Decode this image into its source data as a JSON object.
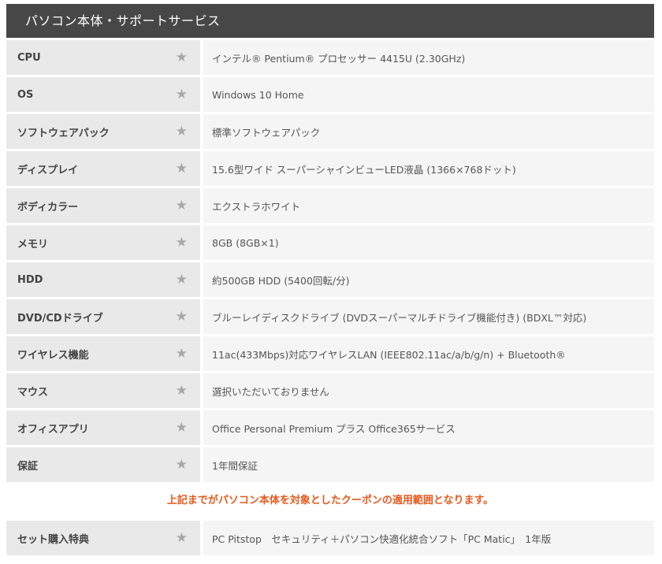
{
  "header": {
    "title": "パソコン本体・サポートサービス"
  },
  "star_icon": "★",
  "spec_rows": [
    {
      "label": "CPU",
      "value": "インテル® Pentium® プロセッサー 4415U (2.30GHz)"
    },
    {
      "label": "OS",
      "value": "Windows 10 Home"
    },
    {
      "label": "ソフトウェアパック",
      "value": "標準ソフトウェアパック"
    },
    {
      "label": "ディスプレイ",
      "value": "15.6型ワイド スーパーシャインビューLED液晶 (1366×768ドット)"
    },
    {
      "label": "ボディカラー",
      "value": "エクストラホワイト"
    },
    {
      "label": "メモリ",
      "value": "8GB (8GB×1)"
    },
    {
      "label": "HDD",
      "value": "約500GB HDD (5400回転/分)"
    },
    {
      "label": "DVD/CDドライブ",
      "value": "ブルーレイディスクドライブ (DVDスーパーマルチドライブ機能付き) (BDXL™対応)"
    },
    {
      "label": "ワイヤレス機能",
      "value": "11ac(433Mbps)対応ワイヤレスLAN (IEEE802.11ac/a/b/g/n) + Bluetooth®"
    },
    {
      "label": "マウス",
      "value": "選択いただいておりません"
    },
    {
      "label": "オフィスアプリ",
      "value": "Office Personal Premium プラス Office365サービス"
    },
    {
      "label": "保証",
      "value": "1年間保証"
    }
  ],
  "notice": "上記までがパソコン本体を対象としたクーポンの適用範囲となります。",
  "bonus_row": {
    "label": "セット購入特典",
    "value": "PC Pitstop　セキュリティ＋パソコン快適化統合ソフト「PC Matic」　1年版"
  },
  "colors": {
    "header_bg": "#474747",
    "label_bg": "#e9e9e9",
    "value_bg": "#f5f5f5",
    "notice_text": "#e55a1e",
    "star": "#a8a8a8"
  }
}
